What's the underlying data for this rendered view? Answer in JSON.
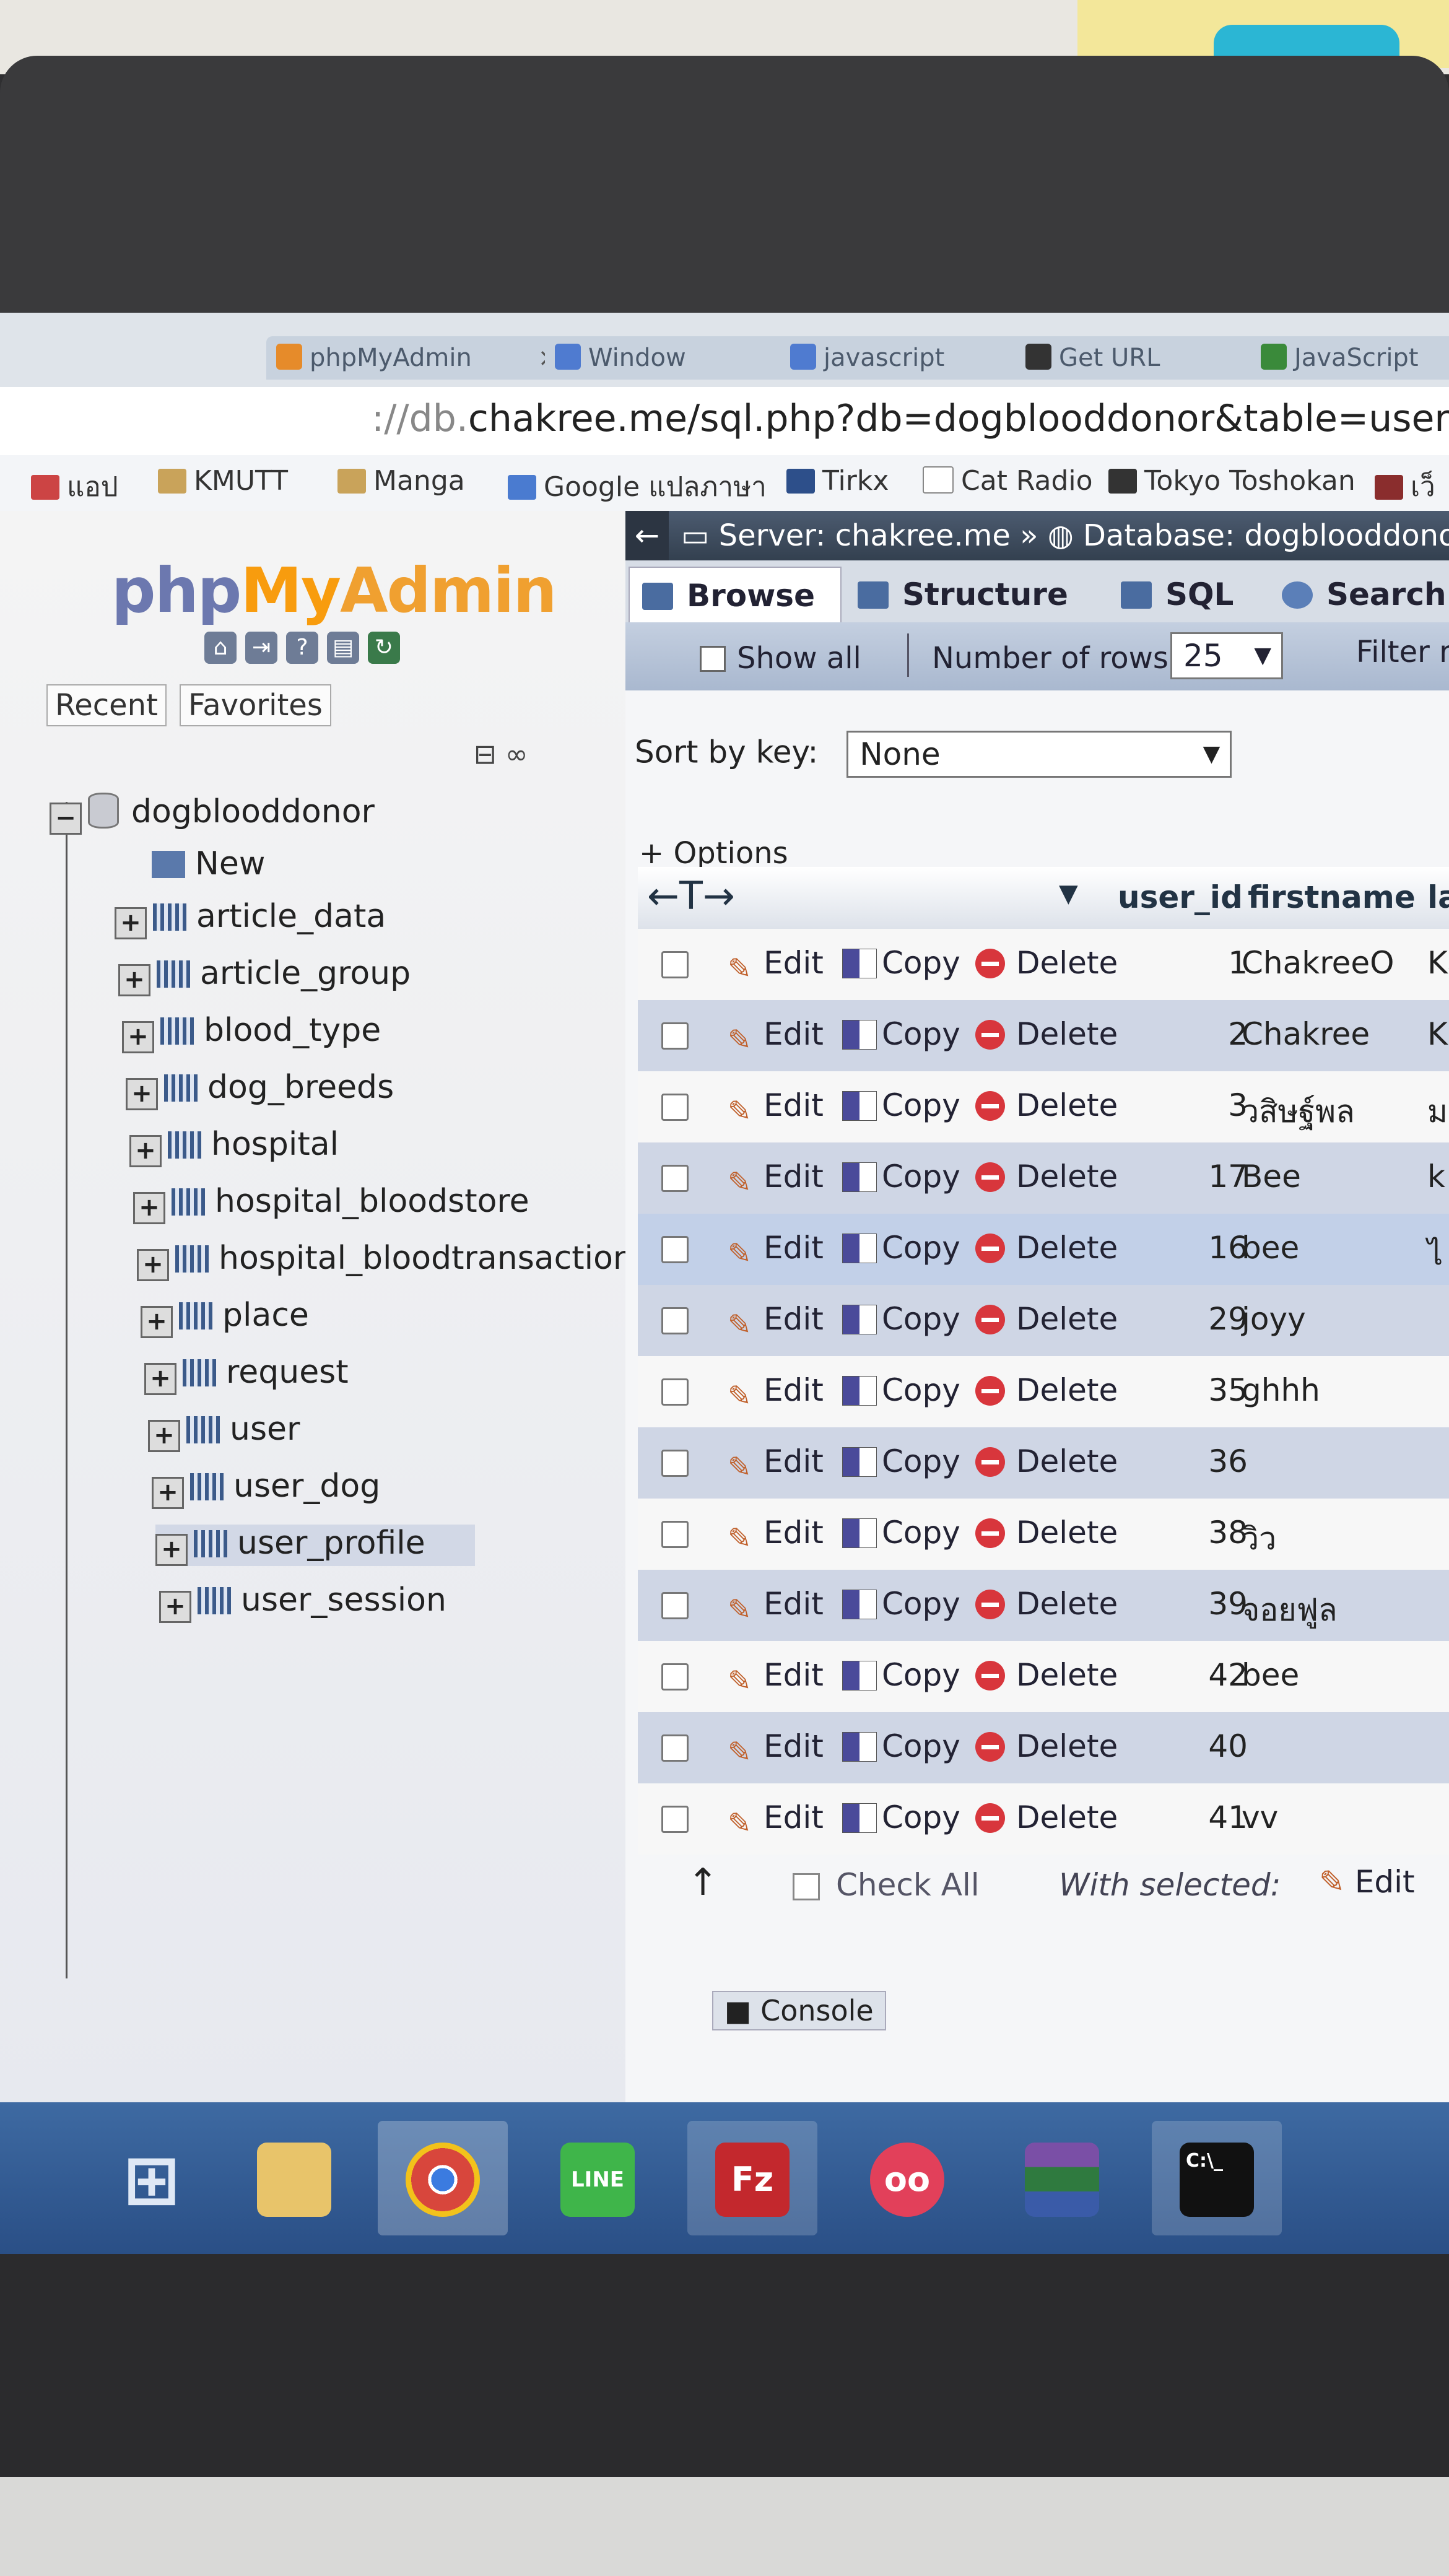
{
  "browser": {
    "tabs": [
      "phpMyAdmin",
      "Window",
      "javascript",
      "Get URL",
      "JavaScript"
    ],
    "url_prefix": "://db.",
    "url": "chakree.me/sql.php?db=dogblooddonor&table=user_profile",
    "bookmarks": [
      "แอป",
      "KMUTT",
      "Manga",
      "Google แปลภาษา",
      "Tirkx",
      "Cat Radio",
      "Tokyo Toshokan",
      "เว็"
    ]
  },
  "nav": {
    "logo_php": "php",
    "logo_my": "My",
    "logo_admin": "Admin",
    "recent": "Recent",
    "favorites": "Favorites",
    "database": "dogblooddonor",
    "new_label": "New",
    "tables": [
      "article_data",
      "article_group",
      "blood_type",
      "dog_breeds",
      "hospital",
      "hospital_bloodstore",
      "hospital_bloodtransaction",
      "place",
      "request",
      "user",
      "user_dog",
      "user_profile",
      "user_session"
    ],
    "selected_table": "user_profile"
  },
  "main": {
    "breadcrumb_server": "Server: chakree.me",
    "breadcrumb_db": "Database: dogblooddonor",
    "tabs": [
      "Browse",
      "Structure",
      "SQL",
      "Search"
    ],
    "show_all": "Show all",
    "number_of_rows_label": "Number of rows:",
    "number_of_rows_value": "25",
    "filter_label": "Filter ro",
    "sort_label": "Sort by key:",
    "sort_value": "None",
    "options_label": "+ Options",
    "col_arrows": "←T→",
    "columns": [
      "user_id",
      "firstname",
      "la"
    ],
    "actions": {
      "edit": "Edit",
      "copy": "Copy",
      "delete": "Delete"
    },
    "rows": [
      {
        "user_id": "1",
        "firstname": "ChakreeO",
        "last": "Ka"
      },
      {
        "user_id": "2",
        "firstname": "Chakree",
        "last": "K"
      },
      {
        "user_id": "3",
        "firstname": "วสิษฐ์พล",
        "last": "ม"
      },
      {
        "user_id": "17",
        "firstname": "Bee",
        "last": "k"
      },
      {
        "user_id": "16",
        "firstname": "bee",
        "last": "ไ"
      },
      {
        "user_id": "29",
        "firstname": "joyy",
        "last": ""
      },
      {
        "user_id": "35",
        "firstname": "ghhh",
        "last": ""
      },
      {
        "user_id": "36",
        "firstname": "",
        "last": ""
      },
      {
        "user_id": "38",
        "firstname": "วิว",
        "last": ""
      },
      {
        "user_id": "39",
        "firstname": "จอยฟูล",
        "last": ""
      },
      {
        "user_id": "42",
        "firstname": "bee",
        "last": ""
      },
      {
        "user_id": "40",
        "firstname": "",
        "last": ""
      },
      {
        "user_id": "41",
        "firstname": "vv",
        "last": ""
      }
    ],
    "check_all": "Check All",
    "with_selected": "With selected:",
    "edit_selected": "Edit",
    "console": "Console"
  },
  "taskbar": {
    "apps": [
      "start-icon",
      "explorer-icon",
      "chrome-icon",
      "line-icon",
      "filezilla-icon",
      "flickr-icon",
      "winrar-icon",
      "cmd-icon"
    ],
    "line_label": "LINE",
    "filezilla_label": "Fz",
    "cmd_label": "C:\\_"
  }
}
